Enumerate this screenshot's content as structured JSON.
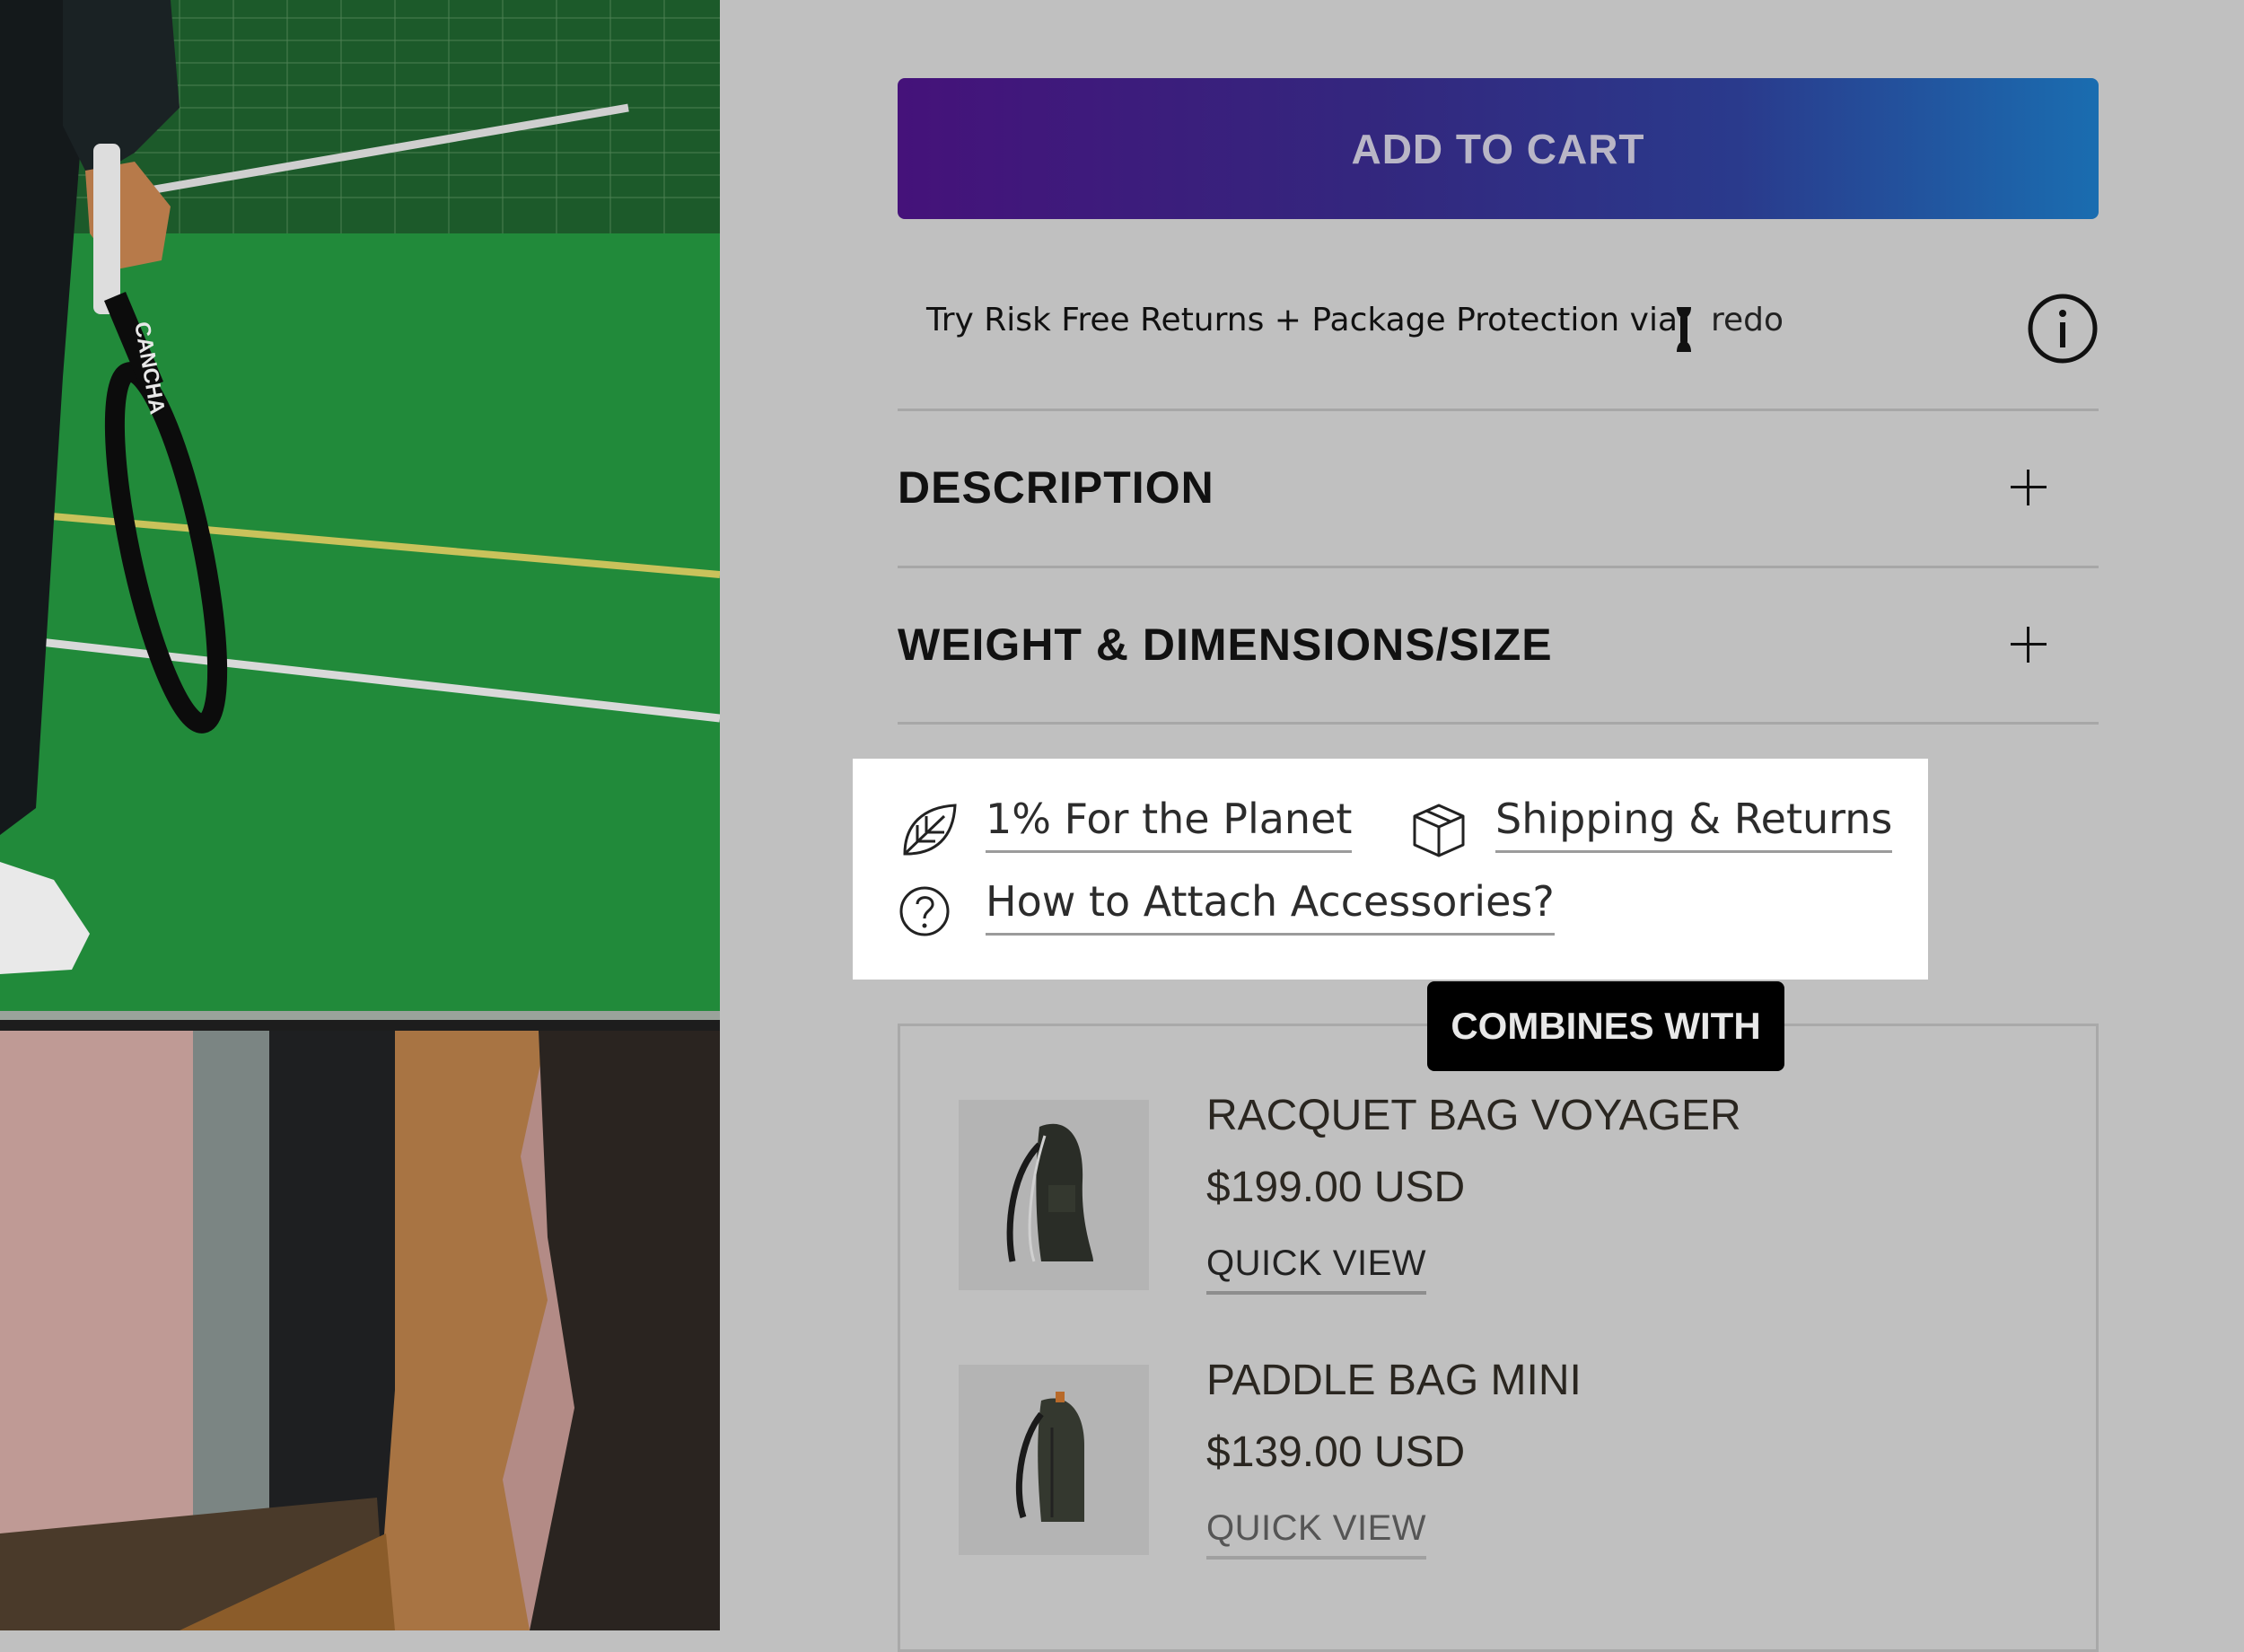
{
  "colors": {
    "page_bg": "#c0c0c0",
    "cta_gradient_start": "#45127a",
    "cta_gradient_end": "#1a6db0",
    "highlight_box": "#ffffff",
    "badge_bg": "#000000"
  },
  "cart": {
    "add_to_cart_label": "ADD TO CART"
  },
  "returns": {
    "text": "Try Risk Free Returns + Package Protection via",
    "brand": "redo",
    "info_icon": "info-circle-icon"
  },
  "accordions": [
    {
      "title": "DESCRIPTION",
      "icon": "plus-icon"
    },
    {
      "title": "WEIGHT & DIMENSIONS/SIZE",
      "icon": "plus-icon"
    }
  ],
  "info_links": [
    {
      "label": "1% For the Planet",
      "icon": "leaf-icon"
    },
    {
      "label": "Shipping & Returns",
      "icon": "box-icon"
    },
    {
      "label": "How to Attach Accessories?",
      "icon": "question-circle-icon"
    }
  ],
  "combines": {
    "badge": "COMBINES WITH",
    "products": [
      {
        "name": "RACQUET BAG VOYAGER",
        "price": "$199.00 USD",
        "action": "QUICK VIEW"
      },
      {
        "name": "PADDLE BAG MINI",
        "price": "$139.00 USD",
        "action": "QUICK VIEW"
      }
    ]
  },
  "gallery": {
    "racquet_text": "CANCHA"
  }
}
